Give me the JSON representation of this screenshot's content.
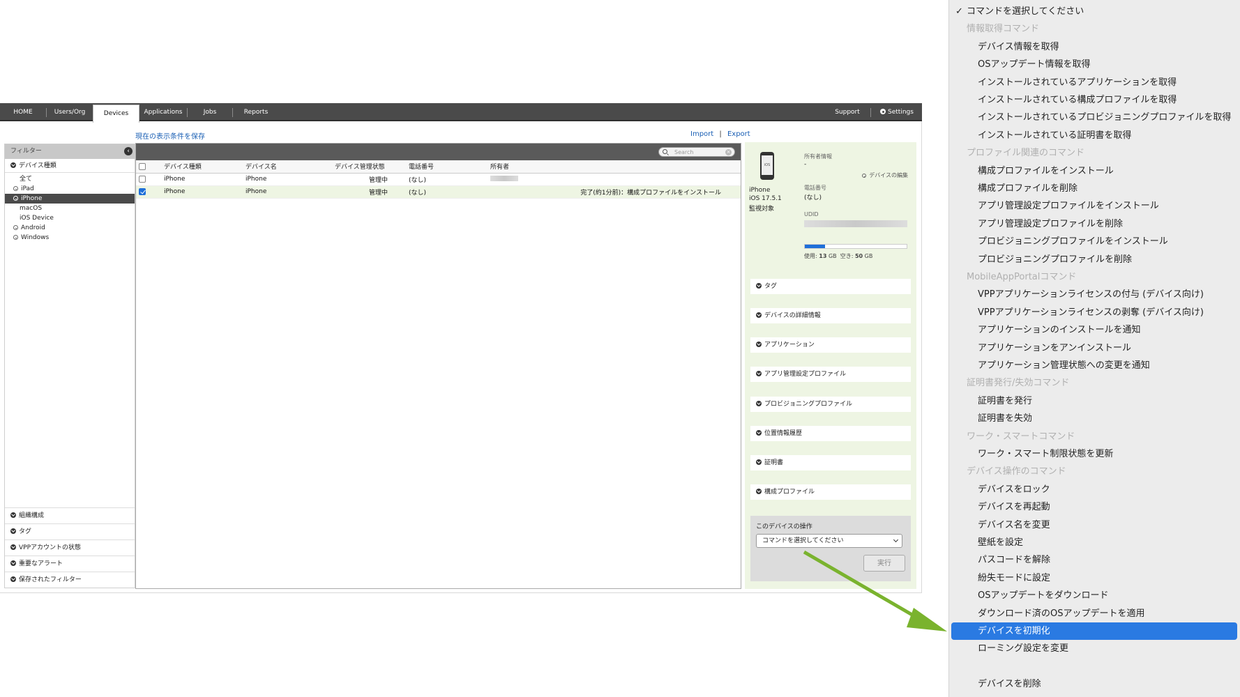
{
  "topnav": {
    "tabs": [
      "HOME",
      "Users/Org",
      "Devices",
      "Applications",
      "Jobs",
      "Reports"
    ],
    "support": "Support",
    "settings": "Settings"
  },
  "toolbar": {
    "save_view": "現在の表示条件を保存",
    "import": "Import",
    "separator": "|",
    "export": "Export"
  },
  "sidebar": {
    "header": "フィルター",
    "section_device_type": "デバイス種類",
    "items": [
      "全て",
      "iPad",
      "iPhone",
      "macOS",
      "iOS Device",
      "Android",
      "Windows"
    ],
    "bottom": [
      "組織構成",
      "タグ",
      "VPPアカウントの状態",
      "重要なアラート",
      "保存されたフィルター"
    ]
  },
  "table": {
    "search_placeholder": "Search",
    "columns": [
      "デバイス種類",
      "デバイス名",
      "デバイス管理状態",
      "電話番号",
      "所有者"
    ],
    "rows": [
      {
        "type": "iPhone",
        "name": "iPhone",
        "state": "管理中",
        "phone": "(なし)",
        "note": ""
      },
      {
        "type": "iPhone",
        "name": "iPhone",
        "state": "管理中",
        "phone": "(なし)",
        "note": "完了(約1分前)：構成プロファイルをインストール"
      }
    ]
  },
  "detail": {
    "model": "iPhone",
    "os": "iOS 17.5.1",
    "supervised": "監視対象",
    "owner_label": "所有者情報",
    "owner_value": "-",
    "edit_link": "デバイスの編集",
    "phone_label": "電話番号",
    "phone_value": "(なし)",
    "udid_label": "UDID",
    "storage_used_label": "使用:",
    "storage_used": "13",
    "storage_free_label": "空き:",
    "storage_free": "50",
    "storage_unit": "GB",
    "storage_used_fraction": 0.2,
    "sections": [
      "タグ",
      "デバイスの詳細情報",
      "アプリケーション",
      "アプリ管理設定プロファイル",
      "プロビジョニングプロファイル",
      "位置情報履歴",
      "証明書",
      "構成プロファイル"
    ],
    "ops_title": "このデバイスの操作",
    "select_value": "コマンドを選択してください",
    "run_button": "実行"
  },
  "command_menu": [
    {
      "kind": "first",
      "label": "コマンドを選択してください"
    },
    {
      "kind": "group",
      "label": "情報取得コマンド"
    },
    {
      "kind": "item",
      "label": "デバイス情報を取得"
    },
    {
      "kind": "item",
      "label": "OSアップデート情報を取得"
    },
    {
      "kind": "item",
      "label": "インストールされているアプリケーションを取得"
    },
    {
      "kind": "item",
      "label": "インストールされている構成プロファイルを取得"
    },
    {
      "kind": "item",
      "label": "インストールされているプロビジョニングプロファイルを取得"
    },
    {
      "kind": "item",
      "label": "インストールされている証明書を取得"
    },
    {
      "kind": "group",
      "label": "プロファイル関連のコマンド"
    },
    {
      "kind": "item",
      "label": "構成プロファイルをインストール"
    },
    {
      "kind": "item",
      "label": "構成プロファイルを削除"
    },
    {
      "kind": "item",
      "label": "アプリ管理設定プロファイルをインストール"
    },
    {
      "kind": "item",
      "label": "アプリ管理設定プロファイルを削除"
    },
    {
      "kind": "item",
      "label": "プロビジョニングプロファイルをインストール"
    },
    {
      "kind": "item",
      "label": "プロビジョニングプロファイルを削除"
    },
    {
      "kind": "group",
      "label": "MobileAppPortalコマンド"
    },
    {
      "kind": "item",
      "label": "VPPアプリケーションライセンスの付与 (デバイス向け)"
    },
    {
      "kind": "item",
      "label": "VPPアプリケーションライセンスの剥奪 (デバイス向け)"
    },
    {
      "kind": "item",
      "label": "アプリケーションのインストールを通知"
    },
    {
      "kind": "item",
      "label": "アプリケーションをアンインストール"
    },
    {
      "kind": "item",
      "label": "アプリケーション管理状態への変更を通知"
    },
    {
      "kind": "group",
      "label": "証明書発行/失効コマンド"
    },
    {
      "kind": "item",
      "label": "証明書を発行"
    },
    {
      "kind": "item",
      "label": "証明書を失効"
    },
    {
      "kind": "group",
      "label": "ワーク・スマートコマンド"
    },
    {
      "kind": "item",
      "label": "ワーク・スマート制限状態を更新"
    },
    {
      "kind": "group",
      "label": "デバイス操作のコマンド"
    },
    {
      "kind": "item",
      "label": "デバイスをロック"
    },
    {
      "kind": "item",
      "label": "デバイスを再起動"
    },
    {
      "kind": "item",
      "label": "デバイス名を変更"
    },
    {
      "kind": "item",
      "label": "壁紙を設定"
    },
    {
      "kind": "item",
      "label": "パスコードを解除"
    },
    {
      "kind": "item",
      "label": "紛失モードに設定"
    },
    {
      "kind": "item",
      "label": "OSアップデートをダウンロード"
    },
    {
      "kind": "item",
      "label": "ダウンロード済のOSアップデートを適用"
    },
    {
      "kind": "item",
      "label": "デバイスを初期化",
      "highlighted": true
    },
    {
      "kind": "item",
      "label": "ローミング設定を変更"
    },
    {
      "kind": "spacer",
      "label": ""
    },
    {
      "kind": "item",
      "label": "デバイスを削除"
    }
  ],
  "colors": {
    "nav_bg": "#4a4a4a",
    "highlight": "#2a7ae2",
    "detail_bg": "#eef5e3",
    "arrow": "#7ab32e"
  }
}
